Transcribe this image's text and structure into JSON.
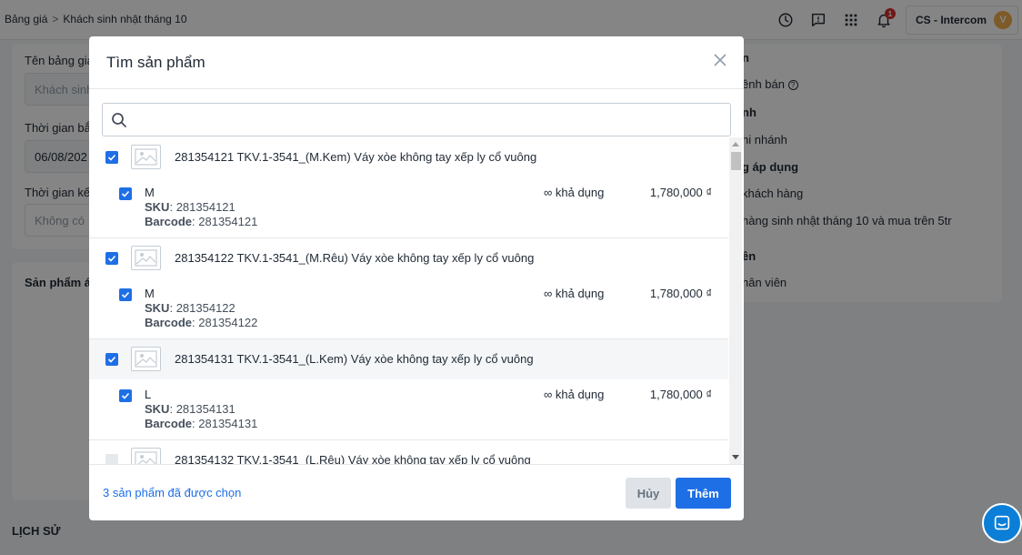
{
  "breadcrumb": {
    "parent": "Bảng giá",
    "separator": ">",
    "current": "Khách sinh nhật tháng 10"
  },
  "account": {
    "name": "CS - Intercom",
    "avatar_letter": "V",
    "notification_count": "1"
  },
  "background": {
    "price_list_name_label": "Tên bảng giá",
    "price_list_name_value": "Khách sinh",
    "start_time_label": "Thời gian bắ",
    "start_time_value": "06/08/202",
    "end_time_label": "Thời gian kế",
    "end_time_placeholder": "Không có",
    "products_label": "Sản phẩm á",
    "history_label": "LỊCH SỬ",
    "right_lines": [
      {
        "text": "n",
        "bold": true
      },
      {
        "text": "ênh bán",
        "bold": false
      },
      {
        "text": "nh",
        "bold": true
      },
      {
        "text": "hi nhánh",
        "bold": false
      },
      {
        "text": "g áp dụng",
        "bold": true
      },
      {
        "text": "khách hàng",
        "bold": false
      },
      {
        "text": "hàng sinh nhật tháng 10 và mua trên 5tr",
        "bold": false
      },
      {
        "text": "ên",
        "bold": true
      },
      {
        "text": "hân viên",
        "bold": false
      }
    ]
  },
  "modal": {
    "title": "Tìm sản phẩm",
    "search_placeholder": "",
    "products": [
      {
        "name": "281354121 TKV.1-3541_(M.Kem) Váy xòe không tay xếp ly cổ vuông",
        "checked": true,
        "variant": {
          "name": "M",
          "sku_label": "SKU",
          "sku": "281354121",
          "barcode_label": "Barcode",
          "barcode": "281354121",
          "availability": "∞ khả dụng",
          "price": "1,780,000 ₫",
          "checked": true
        }
      },
      {
        "name": "281354122 TKV.1-3541_(M.Rêu) Váy xòe không tay xếp ly cổ vuông",
        "checked": true,
        "variant": {
          "name": "M",
          "sku_label": "SKU",
          "sku": "281354122",
          "barcode_label": "Barcode",
          "barcode": "281354122",
          "availability": "∞ khả dụng",
          "price": "1,780,000 ₫",
          "checked": true
        }
      },
      {
        "name": "281354131 TKV.1-3541_(L.Kem) Váy xòe không tay xếp ly cổ vuông",
        "checked": true,
        "variant": {
          "name": "L",
          "sku_label": "SKU",
          "sku": "281354131",
          "barcode_label": "Barcode",
          "barcode": "281354131",
          "availability": "∞ khả dụng",
          "price": "1,780,000 ₫",
          "checked": true
        }
      },
      {
        "name": "281354132 TKV.1-3541_(L.Rêu) Váy xòe không tay xếp ly cổ vuông",
        "checked": false
      }
    ],
    "selected_count": "3 sản phẩm đã được chọn",
    "cancel_label": "Hủy",
    "add_label": "Thêm"
  },
  "colors": {
    "accent": "#1e6fe6",
    "overlay": "rgba(0,0,0,0.48)",
    "chat": "#0b7fd8",
    "avatar": "#f0ad4e",
    "badge": "#d32f2f"
  }
}
